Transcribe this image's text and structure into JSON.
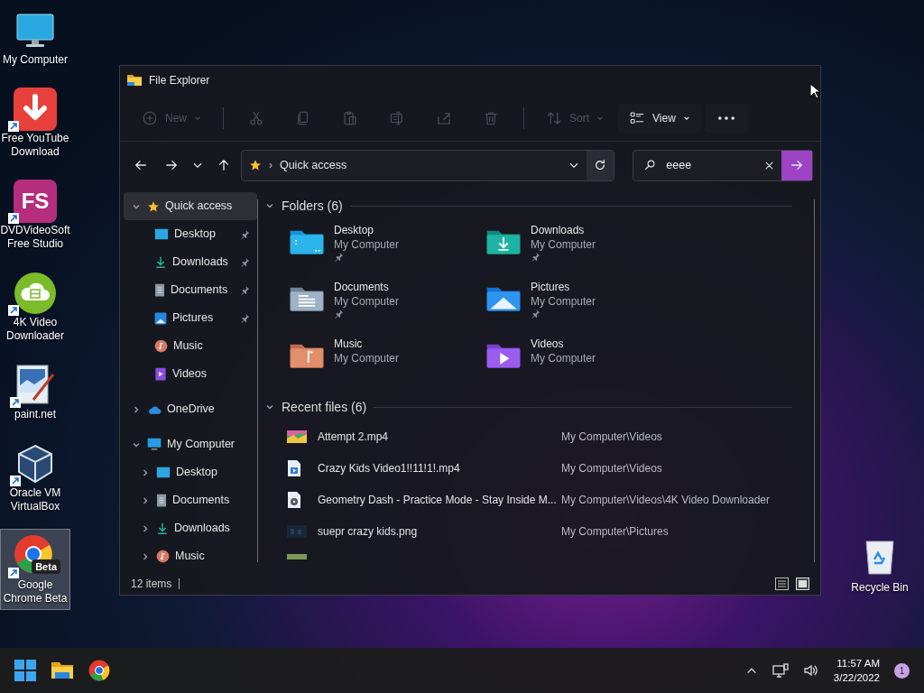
{
  "desktop_icons": [
    {
      "label": "My Computer",
      "kind": "monitor",
      "shortcut": false,
      "selected": false
    },
    {
      "label": "Free YouTube Download",
      "kind": "youtube",
      "shortcut": true,
      "selected": false
    },
    {
      "label": "DVDVideoSoft Free Studio",
      "kind": "fs",
      "shortcut": true,
      "selected": false,
      "glyph": "FS"
    },
    {
      "label": "4K Video Downloader",
      "kind": "cloud",
      "shortcut": true,
      "selected": false
    },
    {
      "label": "paint.net",
      "kind": "paint",
      "shortcut": true,
      "selected": false
    },
    {
      "label": "Oracle VM VirtualBox",
      "kind": "box",
      "shortcut": true,
      "selected": false
    },
    {
      "label": "Google Chrome Beta",
      "kind": "chrome",
      "shortcut": true,
      "selected": true,
      "badge": "Beta"
    }
  ],
  "recycle_bin": {
    "label": "Recycle Bin"
  },
  "window": {
    "title": "File Explorer"
  },
  "toolbar": [
    {
      "kind": "new",
      "label": "New",
      "disabled": true,
      "caret": true
    },
    {
      "kind": "sep"
    },
    {
      "kind": "cut",
      "disabled": true
    },
    {
      "kind": "copy",
      "disabled": true
    },
    {
      "kind": "paste",
      "disabled": true
    },
    {
      "kind": "rename",
      "disabled": true
    },
    {
      "kind": "share",
      "disabled": true
    },
    {
      "kind": "delete",
      "disabled": true
    },
    {
      "kind": "sep"
    },
    {
      "kind": "sort",
      "label": "Sort",
      "disabled": true,
      "caret": true
    },
    {
      "kind": "view",
      "label": "View",
      "disabled": false,
      "caret": true
    },
    {
      "kind": "more",
      "disabled": false
    }
  ],
  "address": {
    "separator": "›",
    "location": "Quick access"
  },
  "search": {
    "value": "eeee"
  },
  "sidebar": [
    {
      "label": "Quick access",
      "kind": "star",
      "expanded": true,
      "selected": true,
      "children": [
        {
          "label": "Desktop",
          "kind": "desktop",
          "pinned": true,
          "selected": false
        },
        {
          "label": "Downloads",
          "kind": "downloads",
          "pinned": true,
          "selected": false
        },
        {
          "label": "Documents",
          "kind": "documents",
          "pinned": true,
          "selected": false
        },
        {
          "label": "Pictures",
          "kind": "pictures",
          "pinned": true,
          "selected": false
        },
        {
          "label": "Music",
          "kind": "music",
          "pinned": false,
          "selected": false
        },
        {
          "label": "Videos",
          "kind": "videos",
          "pinned": false,
          "selected": false
        }
      ]
    },
    {
      "label": "OneDrive",
      "kind": "cloud",
      "expanded": false,
      "selected": false
    },
    {
      "label": "My Computer",
      "kind": "monitor",
      "expanded": true,
      "selected": false,
      "children": [
        {
          "label": "Desktop",
          "kind": "desktop",
          "expanded": false,
          "selected": false
        },
        {
          "label": "Documents",
          "kind": "documents",
          "expanded": false,
          "selected": false
        },
        {
          "label": "Downloads",
          "kind": "downloads",
          "expanded": false,
          "selected": false
        },
        {
          "label": "Music",
          "kind": "music",
          "expanded": false,
          "selected": false
        }
      ]
    }
  ],
  "folders": {
    "title": "Folders (6)",
    "expanded": true,
    "items": [
      {
        "name": "Desktop",
        "location": "My Computer",
        "kind": "desktop",
        "pinned": true
      },
      {
        "name": "Downloads",
        "location": "My Computer",
        "kind": "downloads",
        "pinned": true
      },
      {
        "name": "Documents",
        "location": "My Computer",
        "kind": "documents",
        "pinned": true
      },
      {
        "name": "Pictures",
        "location": "My Computer",
        "kind": "pictures",
        "pinned": true
      },
      {
        "name": "Music",
        "location": "My Computer",
        "kind": "music",
        "pinned": false
      },
      {
        "name": "Videos",
        "location": "My Computer",
        "kind": "videos",
        "pinned": false
      }
    ]
  },
  "recent": {
    "title": "Recent files (6)",
    "expanded": true,
    "items": [
      {
        "name": "Attempt 2.mp4",
        "location": "My Computer\\Videos",
        "kind": "thumb"
      },
      {
        "name": "Crazy Kids Video1!!11!1!.mp4",
        "location": "My Computer\\Videos",
        "kind": "video"
      },
      {
        "name": "Geometry Dash - Practice Mode - Stay Inside M...",
        "location": "My Computer\\Videos\\4K Video Downloader",
        "kind": "audio"
      },
      {
        "name": "suepr crazy kids.png",
        "location": "My Computer\\Pictures",
        "kind": "dark"
      }
    ]
  },
  "status_bar": {
    "items": "12 items"
  },
  "taskbar": {
    "time": "11:57 AM",
    "date": "3/22/2022",
    "notifications": "1"
  }
}
